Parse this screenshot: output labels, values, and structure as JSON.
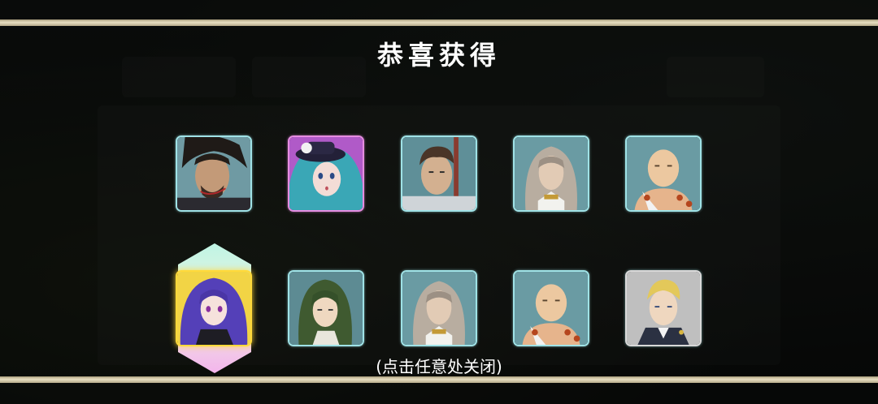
{
  "dialog": {
    "title": "恭喜获得",
    "close_hint": "(点击任意处关闭)"
  },
  "rewards": [
    {
      "name": "bearded-swordsman-portrait",
      "rarity_color": "#9fe2e6"
    },
    {
      "name": "blue-haired-hat-girl-portrait",
      "rarity_color": "#e58ce0"
    },
    {
      "name": "brown-haired-man-portrait",
      "rarity_color": "#9fe2e6"
    },
    {
      "name": "long-gray-haired-man-portrait",
      "rarity_color": "#9fe2e6"
    },
    {
      "name": "bald-monk-portrait",
      "rarity_color": "#9fe2e6"
    },
    {
      "name": "purple-haired-girl-portrait",
      "rarity_color": "#ffd93a",
      "selected": true
    },
    {
      "name": "green-haired-woman-portrait",
      "rarity_color": "#9fe2e6"
    },
    {
      "name": "long-gray-haired-man-portrait",
      "rarity_color": "#9fe2e6"
    },
    {
      "name": "bald-monk-portrait",
      "rarity_color": "#9fe2e6"
    },
    {
      "name": "blonde-young-man-portrait",
      "rarity_color": "#d8d8d8"
    }
  ]
}
